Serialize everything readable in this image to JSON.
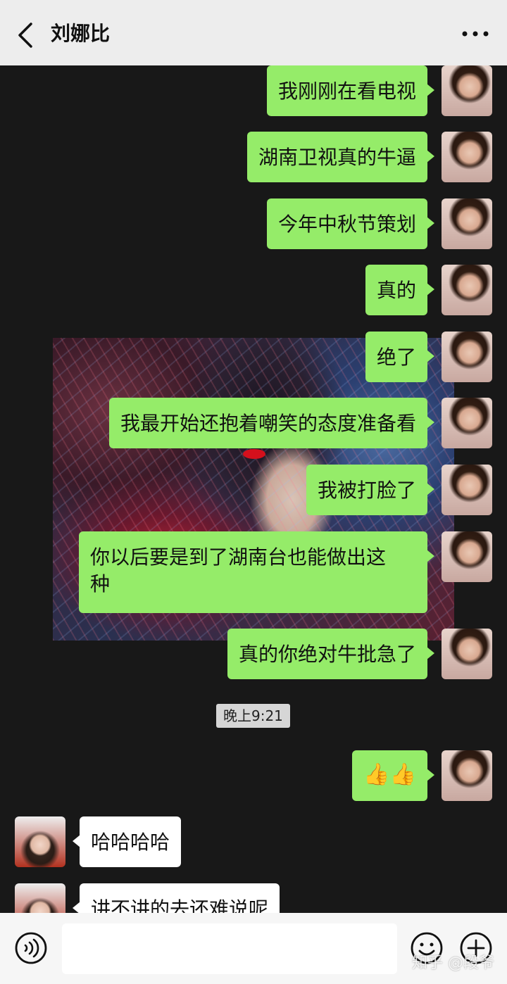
{
  "header": {
    "title": "刘娜比"
  },
  "messages": [
    {
      "side": "me",
      "text": "我刚刚在看电视"
    },
    {
      "side": "me",
      "text": "湖南卫视真的牛逼"
    },
    {
      "side": "me",
      "text": "今年中秋节策划"
    },
    {
      "side": "me",
      "text": "真的"
    },
    {
      "side": "me",
      "text": "绝了"
    },
    {
      "side": "me",
      "text": "我最开始还抱着嘲笑的态度准备看"
    },
    {
      "side": "me",
      "text": "我被打脸了"
    },
    {
      "side": "me",
      "text_line1": "你以后要是到了湖南台也能做出这",
      "text_line2": "种"
    },
    {
      "side": "me",
      "text": "真的你绝对牛批急了"
    },
    {
      "side": "me",
      "emoji": "👍👍"
    },
    {
      "side": "peer",
      "text": "哈哈哈哈"
    },
    {
      "side": "peer",
      "text": "讲不讲的去还难说呢"
    }
  ],
  "timestamp": "晚上9:21",
  "bottom": {
    "input_value": ""
  },
  "watermark": "知乎 @段爷",
  "colors": {
    "my_bubble": "#95ec69",
    "peer_bubble": "#ffffff",
    "header_bg": "#ededed",
    "chat_bg": "#181818"
  },
  "icons": [
    "back-arrow-icon",
    "more-dots-icon",
    "voice-icon",
    "emoji-icon",
    "plus-icon"
  ]
}
